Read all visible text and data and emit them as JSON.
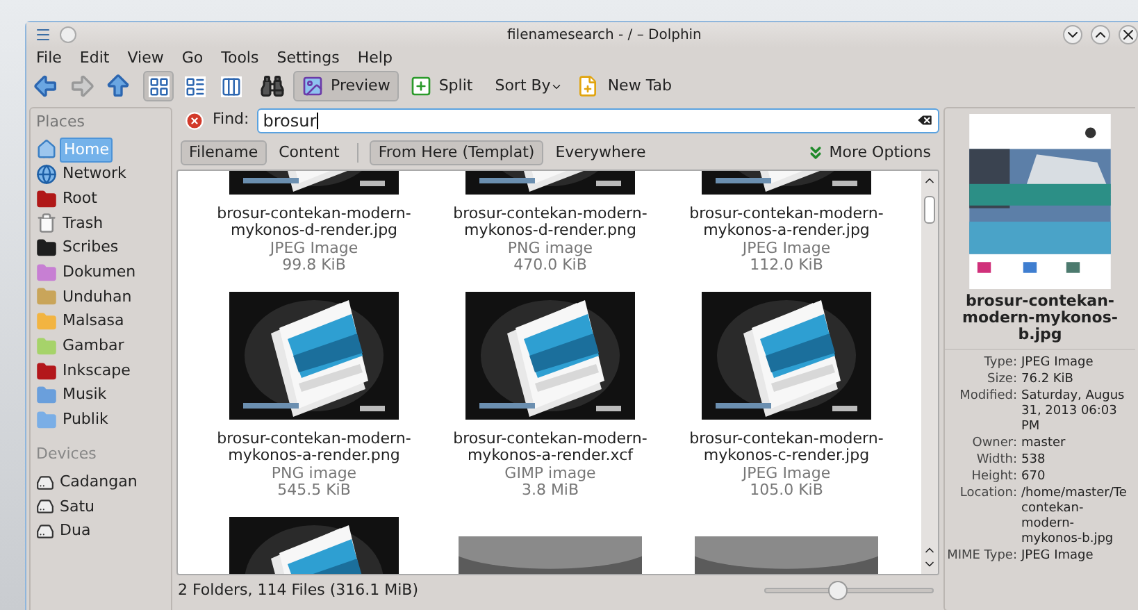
{
  "window": {
    "title": "filenamesearch - / – Dolphin"
  },
  "menu": [
    "File",
    "Edit",
    "View",
    "Go",
    "Tools",
    "Settings",
    "Help"
  ],
  "toolbar": {
    "view_modes": [
      {
        "kind": "icons",
        "selected": true
      },
      {
        "kind": "compact",
        "selected": false
      },
      {
        "kind": "details",
        "selected": false
      }
    ],
    "preview": {
      "label": "Preview",
      "selected": true
    },
    "split": "Split",
    "sort_by": "Sort By",
    "new_tab": "New Tab"
  },
  "places": {
    "heading": "Places",
    "items": [
      {
        "label": "Home",
        "kind": "home",
        "selected": true
      },
      {
        "label": "Network",
        "kind": "network",
        "selected": false
      },
      {
        "label": "Root",
        "kind": "folder",
        "color": "#b01818",
        "selected": false
      },
      {
        "label": "Trash",
        "kind": "trash",
        "selected": false
      },
      {
        "label": "Scribes",
        "kind": "folder",
        "color": "#1e1e1e",
        "selected": false
      },
      {
        "label": "Dokumen",
        "kind": "folder",
        "color": "#c77fd3",
        "selected": false
      },
      {
        "label": "Unduhan",
        "kind": "folder",
        "color": "#c9a55a",
        "selected": false
      },
      {
        "label": "Malsasa",
        "kind": "folder",
        "color": "#f2b441",
        "selected": false
      },
      {
        "label": "Gambar",
        "kind": "folder",
        "color": "#a6d36a",
        "selected": false
      },
      {
        "label": "Inkscape",
        "kind": "folder",
        "color": "#b3171b",
        "selected": false
      },
      {
        "label": "Musik",
        "kind": "folder",
        "color": "#6a9fdc",
        "selected": false
      },
      {
        "label": "Publik",
        "kind": "folder",
        "color": "#7aaee6",
        "selected": false
      }
    ]
  },
  "devices": {
    "heading": "Devices",
    "items": [
      {
        "label": "Cadangan"
      },
      {
        "label": "Satu"
      },
      {
        "label": "Dua"
      }
    ]
  },
  "search": {
    "label": "Find:",
    "value": "brosur"
  },
  "filters": [
    {
      "label": "Filename",
      "selected": true
    },
    {
      "label": "Content",
      "selected": false
    }
  ],
  "scopes": [
    {
      "label": "From Here (Templat)",
      "selected": true
    },
    {
      "label": "Everywhere",
      "selected": false
    }
  ],
  "more_options": "More Options",
  "files": [
    {
      "name": "brosur-contekan-modern-mykonos-d-render.jpg",
      "type": "JPEG Image",
      "size": "99.8 KiB"
    },
    {
      "name": "brosur-contekan-modern-mykonos-d-render.png",
      "type": "PNG image",
      "size": "470.0 KiB"
    },
    {
      "name": "brosur-contekan-modern-mykonos-a-render.jpg",
      "type": "JPEG Image",
      "size": "112.0 KiB"
    },
    {
      "name": "brosur-contekan-modern-mykonos-a-render.png",
      "type": "PNG image",
      "size": "545.5 KiB"
    },
    {
      "name": "brosur-contekan-modern-mykonos-a-render.xcf",
      "type": "GIMP image",
      "size": "3.8 MiB"
    },
    {
      "name": "brosur-contekan-modern-mykonos-c-render.jpg",
      "type": "JPEG Image",
      "size": "105.0 KiB"
    },
    {
      "kind": "picture"
    },
    {
      "kind": "picture"
    },
    {
      "kind": "picture"
    }
  ],
  "status": "2 Folders, 114 Files (316.1 MiB)",
  "zoom": {
    "level": 0.43
  },
  "info": {
    "name": "brosur-contekan-modern-mykonos-b.jpg",
    "rows": [
      {
        "label": "Type:",
        "lines": [
          "JPEG Image"
        ]
      },
      {
        "label": "Size:",
        "lines": [
          "76.2 KiB"
        ]
      },
      {
        "label": "Modified:",
        "lines": [
          "Saturday, Augus",
          "31, 2013 06:03",
          "PM"
        ]
      },
      {
        "label": "Owner:",
        "lines": [
          "master"
        ]
      },
      {
        "label": "Width:",
        "lines": [
          "538"
        ]
      },
      {
        "label": "Height:",
        "lines": [
          "670"
        ]
      },
      {
        "label": "Location:",
        "lines": [
          "/home/master/Te",
          "contekan-",
          "modern-",
          "mykonos-b.jpg"
        ]
      },
      {
        "label": "MIME Type:",
        "lines": [
          "JPEG Image"
        ]
      }
    ]
  }
}
